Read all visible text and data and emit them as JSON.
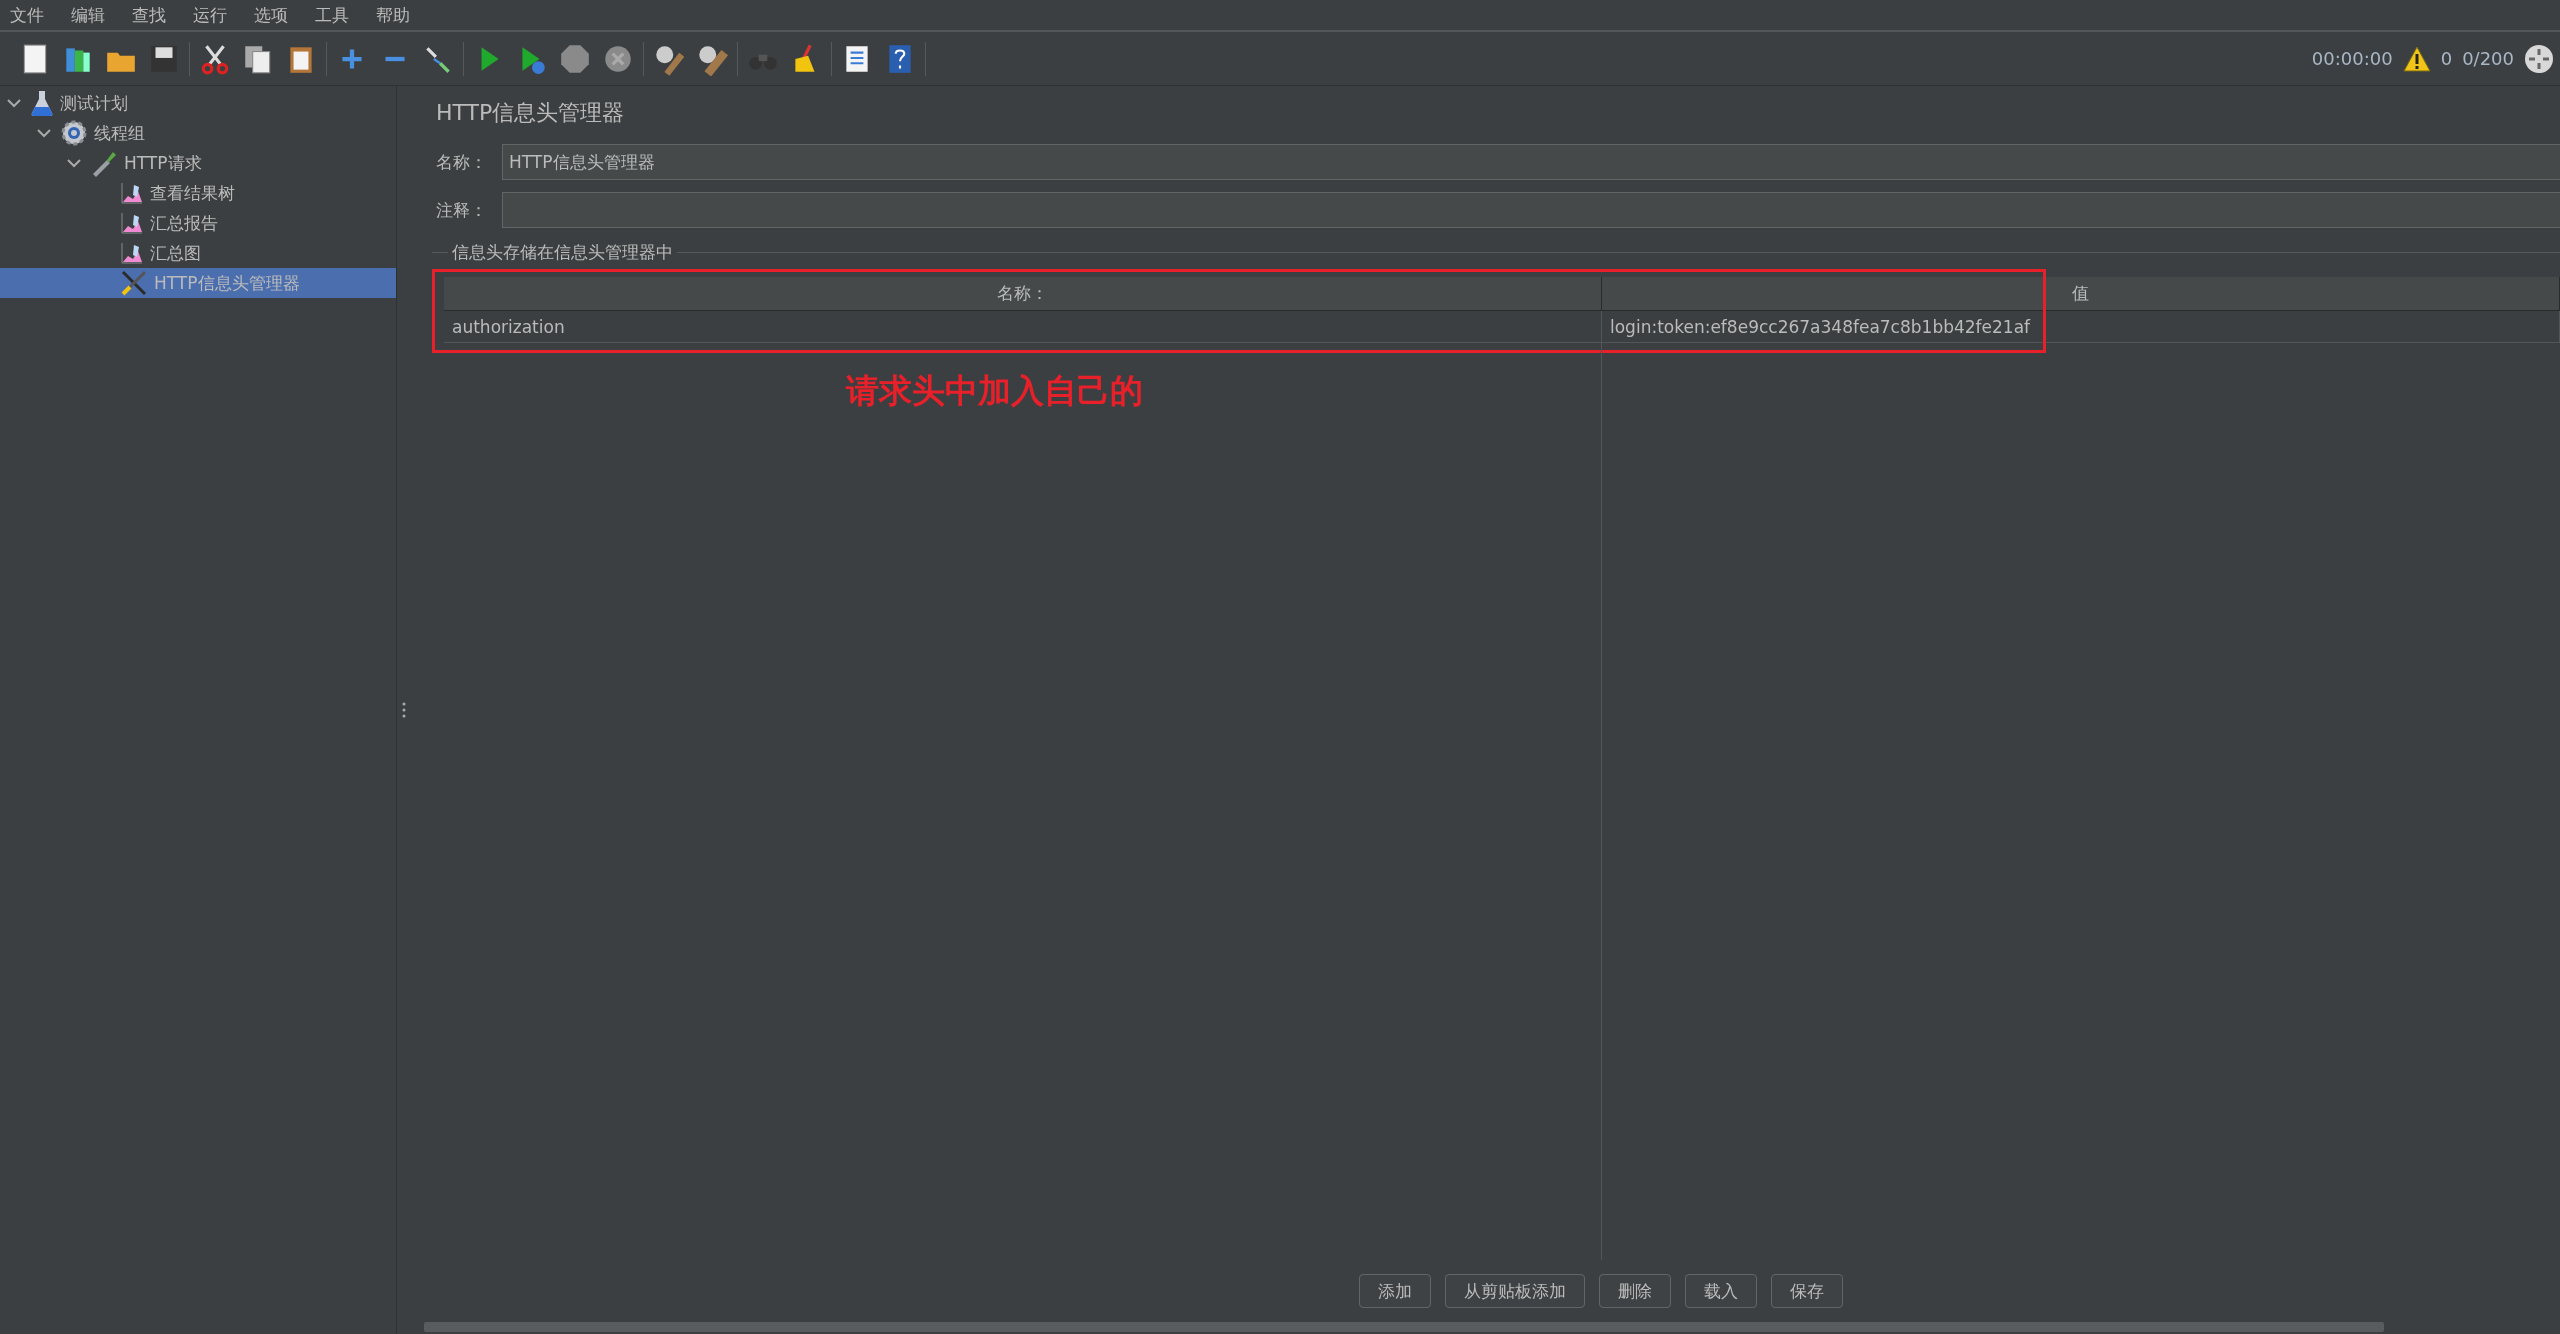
{
  "menu": [
    "文件",
    "编辑",
    "查找",
    "运行",
    "选项",
    "工具",
    "帮助"
  ],
  "status": {
    "time": "00:00:00",
    "warnings": "0",
    "threads": "0/200"
  },
  "tree": [
    {
      "label": "测试计划",
      "kind": "plan",
      "expanded": true,
      "selected": false,
      "children": [
        {
          "label": "线程组",
          "kind": "threads",
          "expanded": true,
          "selected": false,
          "children": [
            {
              "label": "HTTP请求",
              "kind": "sampler",
              "expanded": true,
              "selected": false,
              "children": [
                {
                  "label": "查看结果树",
                  "kind": "listener",
                  "selected": false
                },
                {
                  "label": "汇总报告",
                  "kind": "listener",
                  "selected": false
                },
                {
                  "label": "汇总图",
                  "kind": "listener",
                  "selected": false
                },
                {
                  "label": "HTTP信息头管理器",
                  "kind": "config",
                  "selected": true
                }
              ]
            }
          ]
        }
      ]
    }
  ],
  "panel": {
    "title": "HTTP信息头管理器",
    "name_label": "名称：",
    "name_value": "HTTP信息头管理器",
    "comment_label": "注释：",
    "group_label": "信息头存储在信息头管理器中",
    "columns": [
      "名称：",
      "值"
    ],
    "rows": [
      [
        "authorization",
        "login:token:ef8e9cc267a348fea7c8b1bb42fe21af"
      ]
    ],
    "annotation": "请求头中加入自己的",
    "buttons": [
      "添加",
      "从剪贴板添加",
      "删除",
      "载入",
      "保存"
    ]
  }
}
